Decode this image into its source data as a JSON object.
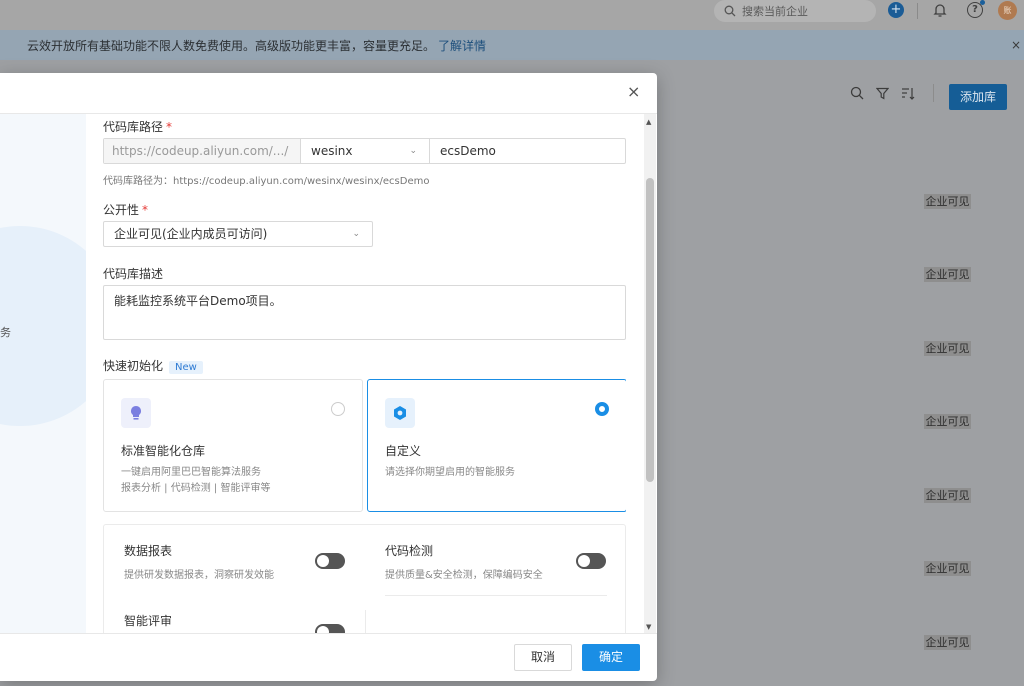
{
  "topbar": {
    "search_placeholder": "搜索当前企业",
    "plus_symbol": "+",
    "help_symbol": "?",
    "avatar_text": "账"
  },
  "notice": {
    "text": "云效开放所有基础功能不限人数免费使用。高级版功能更丰富，容量更充足。",
    "link": "了解详情",
    "close": "×"
  },
  "background": {
    "add_button": "添加库",
    "visibility_tags": [
      "企业可见",
      "企业可见",
      "企业可见",
      "企业可见",
      "企业可见",
      "企业可见",
      "企业可见"
    ]
  },
  "modal": {
    "close": "×",
    "left_pane_text": "务",
    "repo_path": {
      "label": "代码库路径",
      "prefix": "https://codeup.aliyun.com/.../",
      "namespace": "wesinx",
      "name": "ecsDemo",
      "hint": "代码库路径为：https://codeup.aliyun.com/wesinx/wesinx/ecsDemo"
    },
    "visibility": {
      "label": "公开性",
      "value": "企业可见(企业内成员可访问)"
    },
    "description": {
      "label": "代码库描述",
      "value": "能耗监控系统平台Demo项目。"
    },
    "quick_init": {
      "label": "快速初始化",
      "badge": "New",
      "cards": [
        {
          "title": "标准智能化仓库",
          "desc_line1": "一键启用阿里巴巴智能算法服务",
          "desc_line2": "报表分析 | 代码检测 | 智能评审等",
          "selected": false
        },
        {
          "title": "自定义",
          "desc_line1": "请选择你期望启用的智能服务",
          "selected": true
        }
      ]
    },
    "services": [
      {
        "title": "数据报表",
        "desc": "提供研发数据报表，洞察研发效能",
        "enabled": false
      },
      {
        "title": "代码检测",
        "desc": "提供质量&安全检测，保障编码安全",
        "enabled": false
      },
      {
        "title": "智能评审",
        "enabled": false
      }
    ],
    "footer": {
      "cancel": "取消",
      "confirm": "确定"
    }
  },
  "colors": {
    "primary": "#1a8ee5",
    "required": "#e53935",
    "toggle_off": "#555555"
  }
}
